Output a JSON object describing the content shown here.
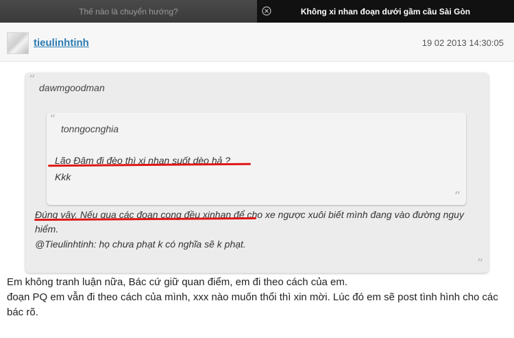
{
  "tabs": [
    {
      "label": "Thế nào là chuyển hướng?",
      "active": false
    },
    {
      "label": "Không xi nhan đoạn dưới gầm cầu Sài Gòn",
      "active": true
    }
  ],
  "icons": {
    "tab_close": "close-circle-icon",
    "avatar": "user-avatar"
  },
  "post": {
    "username": "tieulinhtinh",
    "timestamp": "19 02 2013 14:30:05"
  },
  "quote_outer": {
    "author": "dawmgoodman",
    "inner": {
      "author": "tonngocnghia",
      "lines": [
        "Lão Đâm đi đèo thì xi nhan suốt dèo hả ?",
        "Kkk"
      ]
    },
    "lines": [
      "Đúng vậy. Nếu qua các đoạn cong đều xinhan để cho xe ngược xuôi biết mình đang vào đường nguy hiểm.",
      "@Tieulinhtinh: họ chưa phạt k có nghĩa sẽ k phạt."
    ]
  },
  "body": [
    "Em không tranh luận nữa, Bác cứ giữ quan điểm, em đi theo cách của em.",
    "đoạn PQ em vẫn đi theo cách của mình, xxx nào muốn thổi thì xin mời. Lúc đó em sẽ post tình hình cho các bác rõ."
  ],
  "colors": {
    "username_link": "#2a7ab0",
    "annotation_underline": "#e01515",
    "active_tab": "#111111"
  }
}
